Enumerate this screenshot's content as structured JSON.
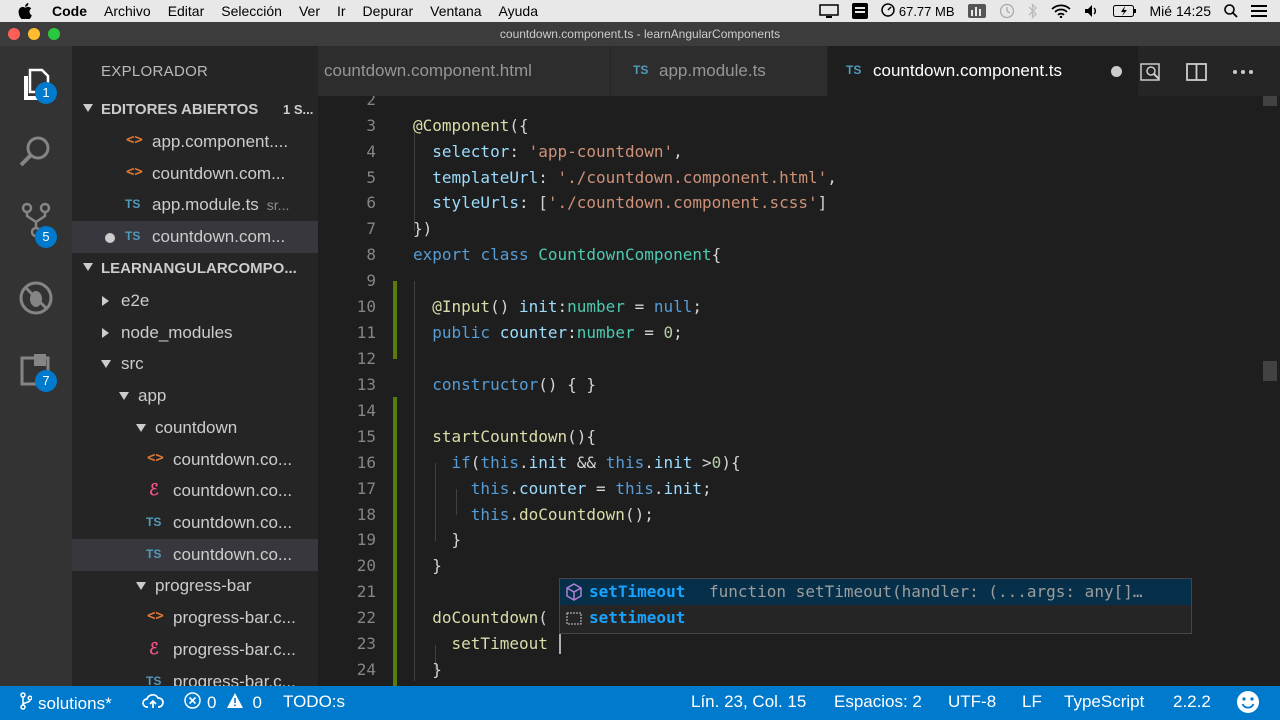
{
  "menubar": {
    "app": "Code",
    "items": [
      "Archivo",
      "Editar",
      "Selección",
      "Ver",
      "Ir",
      "Depurar",
      "Ventana",
      "Ayuda"
    ],
    "memory": "67.77 MB",
    "clock": "Mié 14:25"
  },
  "window": {
    "title": "countdown.component.ts - learnAngularComponents"
  },
  "activity": {
    "explorer_badge": "1",
    "git_badge": "5",
    "extensions_badge": "7"
  },
  "sidebar": {
    "title": "EXPLORADOR",
    "open_editors": {
      "label": "EDITORES ABIERTOS",
      "count": "1 S...",
      "items": [
        {
          "type": "html",
          "label": "app.component....",
          "sub": ""
        },
        {
          "type": "html",
          "label": "countdown.com...",
          "sub": ""
        },
        {
          "type": "ts",
          "label": "app.module.ts",
          "sub": "sr..."
        },
        {
          "type": "ts",
          "label": "countdown.com...",
          "sub": ""
        }
      ]
    },
    "project": {
      "label": "LEARNANGULARCOMPO...",
      "items": [
        {
          "label": "e2e"
        },
        {
          "label": "node_modules"
        },
        {
          "label": "src"
        },
        {
          "label": "app"
        },
        {
          "label": "countdown"
        },
        {
          "type": "html",
          "label": "countdown.co..."
        },
        {
          "type": "scss",
          "label": "countdown.co..."
        },
        {
          "type": "ts",
          "label": "countdown.co..."
        },
        {
          "type": "ts",
          "label": "countdown.co..."
        },
        {
          "label": "progress-bar"
        },
        {
          "type": "html",
          "label": "progress-bar.c..."
        },
        {
          "type": "scss",
          "label": "progress-bar.c..."
        },
        {
          "type": "ts",
          "label": "progress-bar.c..."
        }
      ]
    }
  },
  "tabs": [
    {
      "label": "countdown.component.html",
      "icon": ""
    },
    {
      "label": "app.module.ts",
      "icon": "TS"
    },
    {
      "label": "countdown.component.ts",
      "icon": "TS"
    }
  ],
  "editor": {
    "lines": [
      {
        "n": "2",
        "code": ""
      },
      {
        "n": "3",
        "code": "@Component({"
      },
      {
        "n": "4",
        "code": "  selector: 'app-countdown',"
      },
      {
        "n": "5",
        "code": "  templateUrl: './countdown.component.html',"
      },
      {
        "n": "6",
        "code": "  styleUrls: ['./countdown.component.scss']"
      },
      {
        "n": "7",
        "code": "})"
      },
      {
        "n": "8",
        "code": "export class CountdownComponent{"
      },
      {
        "n": "9",
        "code": ""
      },
      {
        "n": "10",
        "code": "  @Input() init:number = null;"
      },
      {
        "n": "11",
        "code": "  public counter:number = 0;"
      },
      {
        "n": "12",
        "code": ""
      },
      {
        "n": "13",
        "code": "  constructor() { }"
      },
      {
        "n": "14",
        "code": ""
      },
      {
        "n": "15",
        "code": "  startCountdown(){"
      },
      {
        "n": "16",
        "code": "    if(this.init && this.init >0){"
      },
      {
        "n": "17",
        "code": "      this.counter = this.init;"
      },
      {
        "n": "18",
        "code": "      this.doCountdown();"
      },
      {
        "n": "19",
        "code": "    }"
      },
      {
        "n": "20",
        "code": "  }"
      },
      {
        "n": "21",
        "code": ""
      },
      {
        "n": "22",
        "code": "  doCountdown("
      },
      {
        "n": "23",
        "code": "    setTimeout"
      },
      {
        "n": "24",
        "code": "  }"
      }
    ],
    "suggestions": [
      {
        "label": "setTimeout",
        "detail": "function setTimeout(handler: (...args: any[]…"
      },
      {
        "label": "settimeout",
        "detail": ""
      }
    ]
  },
  "statusbar": {
    "branch": "solutions*",
    "errors": "0",
    "warnings": "0",
    "todo": "TODO:s",
    "position": "Lín. 23, Col. 15",
    "spaces": "Espacios: 2",
    "encoding": "UTF-8",
    "eol": "LF",
    "language": "TypeScript",
    "version": "2.2.2"
  }
}
